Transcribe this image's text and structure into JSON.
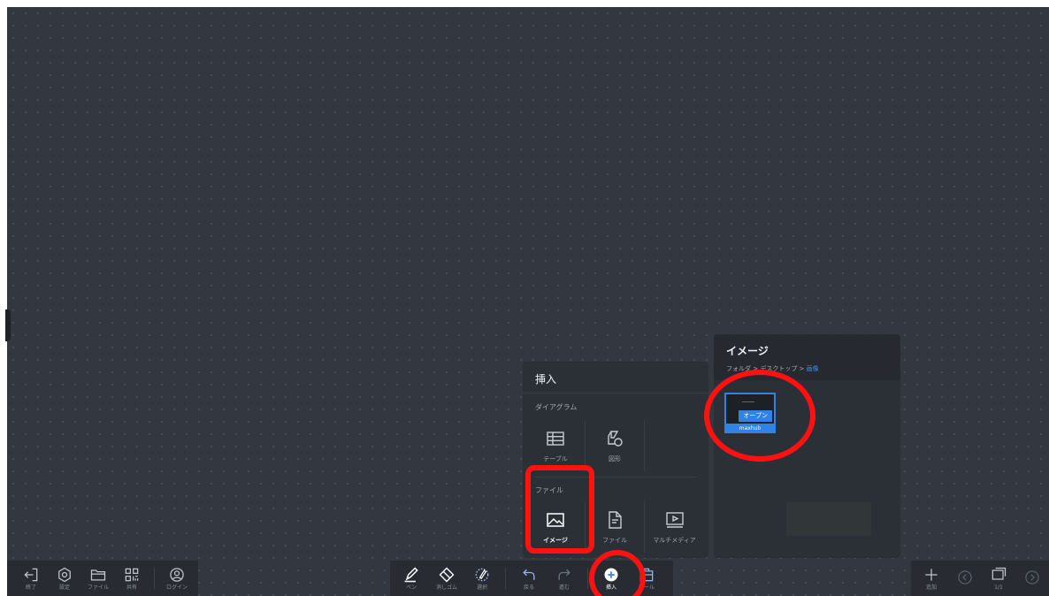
{
  "insert_panel": {
    "title": "挿入",
    "diagram_section": "ダイアグラム",
    "diagram_items": [
      {
        "label": "テーブル",
        "icon": "table-icon"
      },
      {
        "label": "図形",
        "icon": "shape-icon"
      }
    ],
    "file_section": "ファイル",
    "file_items": [
      {
        "label": "イメージ",
        "icon": "image-icon"
      },
      {
        "label": "ファイル",
        "icon": "file-icon"
      },
      {
        "label": "マルチメディア",
        "icon": "multimedia-icon"
      }
    ]
  },
  "image_panel": {
    "title": "イメージ",
    "breadcrumb": {
      "part1": "フォルダ",
      "sep1": " > ",
      "part2": "デスクトップ",
      "sep2": " > ",
      "current": "画像"
    },
    "thumbnail": {
      "name": "maxhub",
      "open_label": "オープン"
    }
  },
  "toolbar_left": [
    {
      "label": "終了",
      "icon": "exit-icon"
    },
    {
      "label": "設定",
      "icon": "gear-icon"
    },
    {
      "label": "ファイル",
      "icon": "folder-icon"
    },
    {
      "label": "共有",
      "icon": "qr-icon"
    },
    {
      "label": "ログイン",
      "icon": "user-icon"
    }
  ],
  "toolbar_center": [
    {
      "label": "ペン",
      "icon": "pen-icon"
    },
    {
      "label": "消しゴム",
      "icon": "eraser-icon"
    },
    {
      "label": "選択",
      "icon": "lasso-icon"
    },
    {
      "label": "戻る",
      "icon": "undo-icon"
    },
    {
      "label": "進む",
      "icon": "redo-icon"
    },
    {
      "label": "挿入",
      "icon": "plus-circle-icon"
    },
    {
      "label": "ツール",
      "icon": "toolbox-icon"
    }
  ],
  "toolbar_right": [
    {
      "label": "追加",
      "icon": "plus-icon"
    },
    {
      "label": "",
      "icon": "chevron-left-icon"
    },
    {
      "label": "1/1",
      "icon": "pages-icon"
    },
    {
      "label": "",
      "icon": "chevron-right-icon"
    }
  ],
  "colors": {
    "accent": "#2f82e6",
    "highlight": "#ff1111",
    "canvas": "#333840"
  }
}
